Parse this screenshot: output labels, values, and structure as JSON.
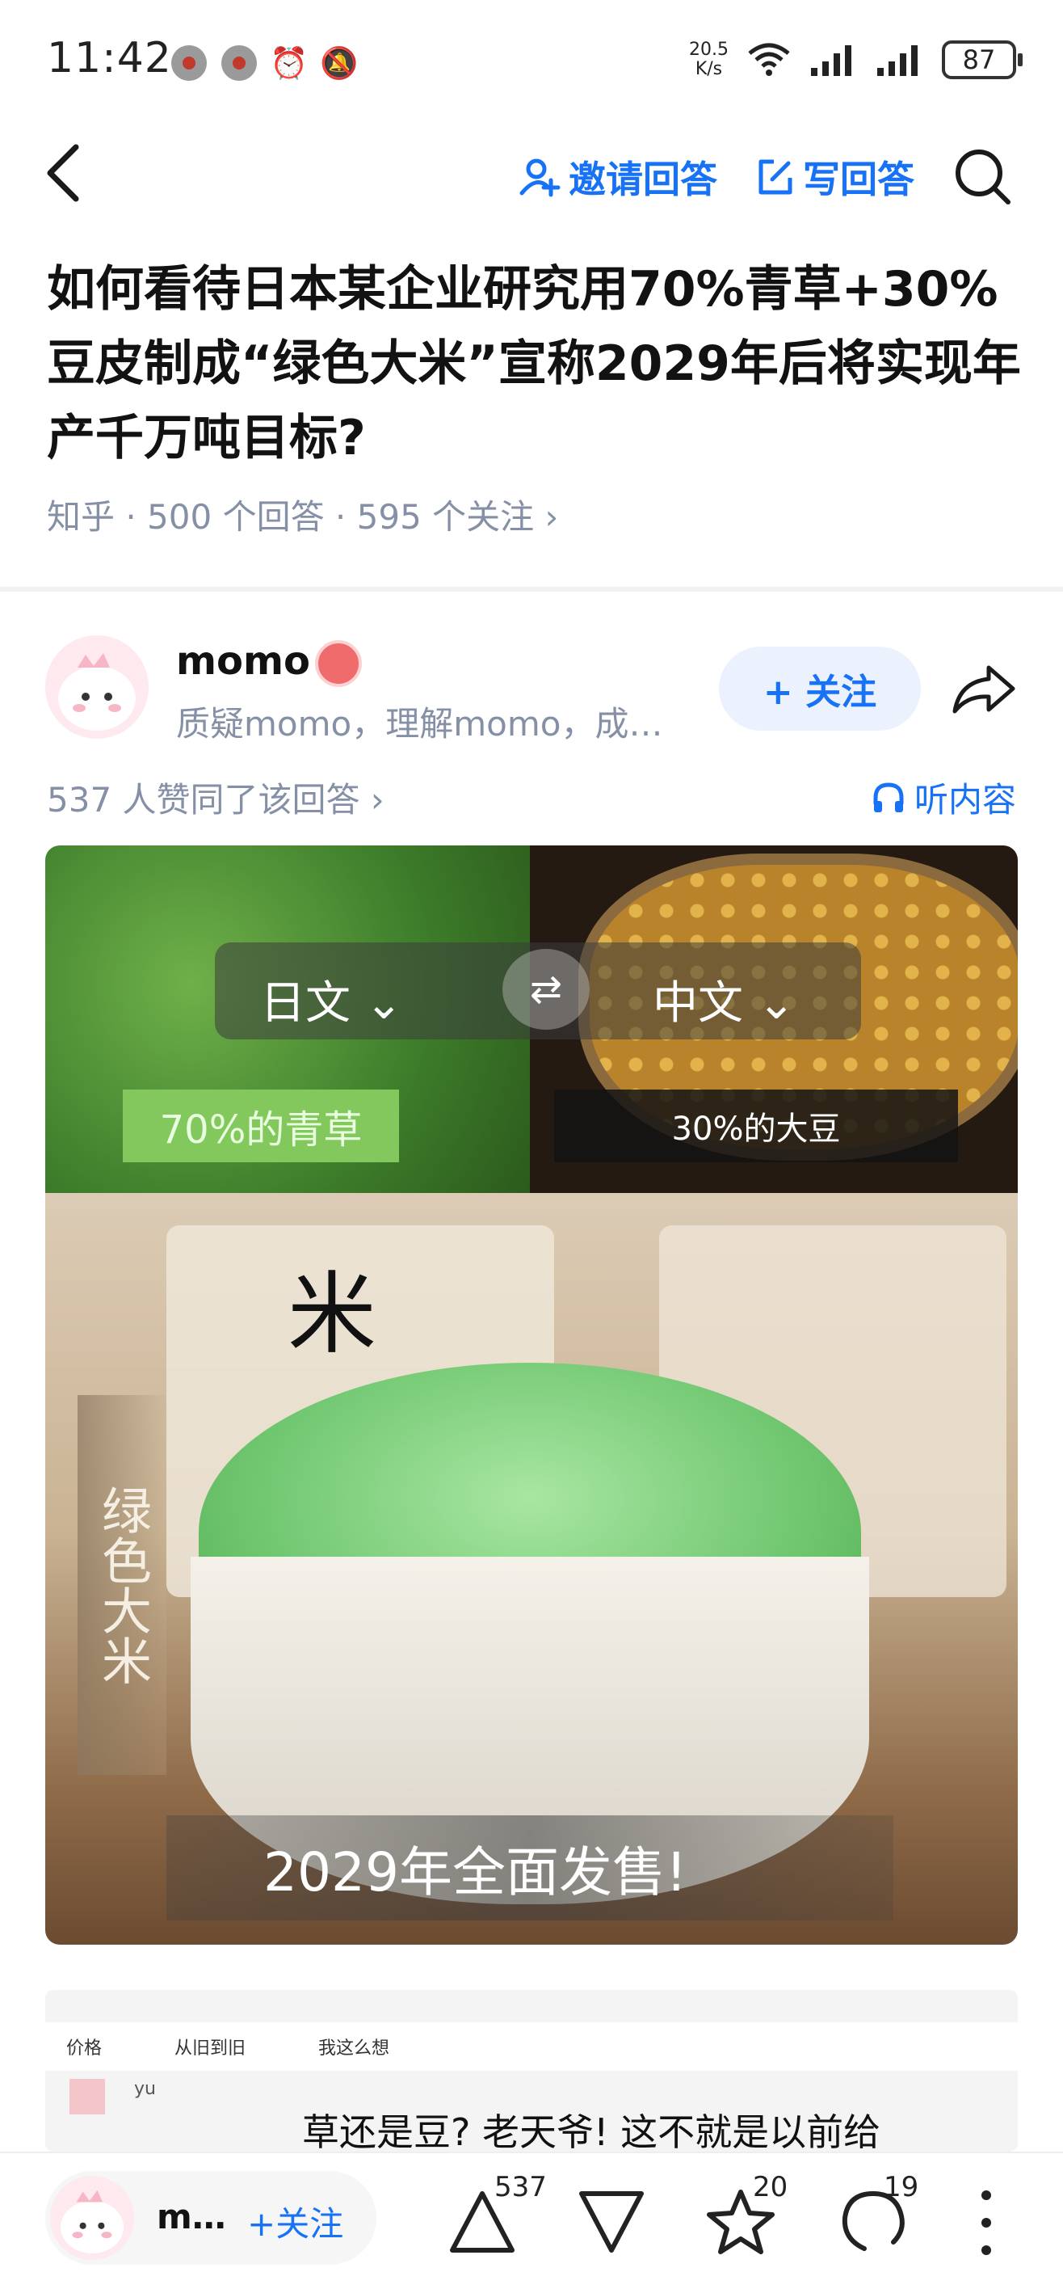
{
  "status_bar": {
    "time": "11:42",
    "net_speed_value": "20.5",
    "net_speed_unit": "K/s",
    "battery": "87"
  },
  "nav": {
    "invite_label": "邀请回答",
    "write_label": "写回答"
  },
  "question": {
    "title": "如何看待日本某企业研究用70%青草+30%豆皮制成“绿色大米”宣称2029年后将实现年产千万吨目标?",
    "meta": "知乎 · 500 个回答 · 595 个关注 ›"
  },
  "answer": {
    "author_name": "momo",
    "author_bio": "质疑momo，理解momo，成…",
    "follow_label": "+ 关注",
    "likes_line": "537 人赞同了该回答 ›",
    "listen_label": "听内容"
  },
  "image": {
    "lang_left": "日文 ⌄",
    "lang_right": "中文 ⌄",
    "tag_grass": "70%的青草",
    "tag_soy": "30%的大豆",
    "mi_char": "米",
    "vertical_text": "绿色大米",
    "caption": "2029年全面发售!"
  },
  "second_image": {
    "tab_1": "价格",
    "tab_2": "从旧到旧",
    "tab_3": "我这么想",
    "user": "yu",
    "snippet": "草还是豆? 老天爷! 这不就是以前给"
  },
  "bottom_bar": {
    "author_short": "m…",
    "follow_label": "+关注",
    "upvote_count": "537",
    "favorite_count": "20",
    "comment_count": "19"
  },
  "colors": {
    "accent_blue": "#1772f6",
    "meta_gray": "#8590a6"
  }
}
